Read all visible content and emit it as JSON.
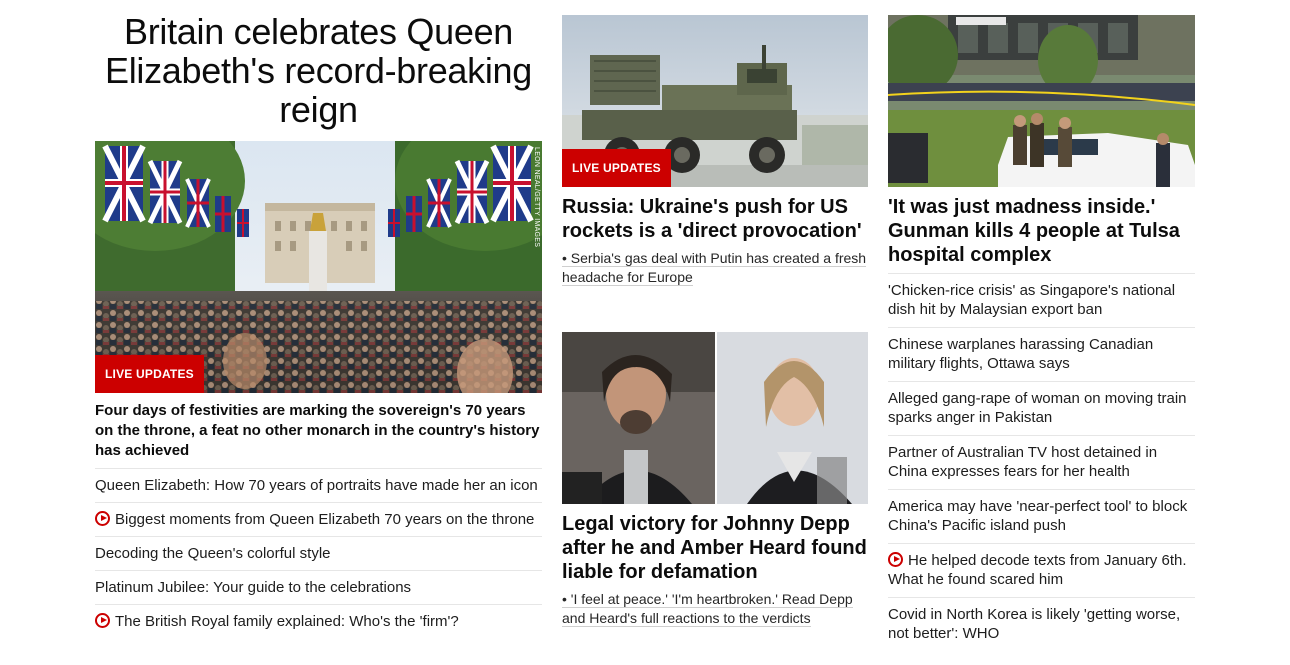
{
  "colors": {
    "accent": "#cc0000",
    "text": "#0c0c0c",
    "divider": "#e6e6e6"
  },
  "main": {
    "title": "Britain celebrates Queen Elizabeth's record-breaking reign",
    "image_credit": "LEON NEAL/GETTY IMAGES",
    "badge": "LIVE UPDATES",
    "subhead": "Four days of festivities are marking the sovereign's 70 years on the throne, a feat no other monarch in the country's history has achieved",
    "links": [
      {
        "text": "Queen Elizabeth: How 70 years of portraits have made her an icon",
        "icon": ""
      },
      {
        "text": "Biggest moments from Queen Elizabeth 70 years on the throne",
        "icon": "play-icon"
      },
      {
        "text": "Decoding the Queen's colorful style",
        "icon": ""
      },
      {
        "text": "Platinum Jubilee: Your guide to the celebrations",
        "icon": ""
      },
      {
        "text": "The British Royal family explained: Who's the 'firm'?",
        "icon": "play-icon"
      }
    ]
  },
  "middle": {
    "card1": {
      "badge": "LIVE UPDATES",
      "title": "Russia: Ukraine's push for US rockets is a 'direct provocation'",
      "sub": "• Serbia's gas deal with Putin has created a fresh headache for Europe"
    },
    "card2": {
      "title": "Legal victory for Johnny Depp after he and Amber Heard found liable for defamation",
      "sub": "• 'I feel at peace.' 'I'm heartbroken.' Read Depp and Heard's full reactions to the verdicts"
    }
  },
  "right": {
    "title": "'It was just madness inside.' Gunman kills 4 people at Tulsa hospital complex",
    "links": [
      {
        "text": "'Chicken-rice crisis' as Singapore's national dish hit by Malaysian export ban",
        "icon": ""
      },
      {
        "text": "Chinese warplanes harassing Canadian military flights, Ottawa says",
        "icon": ""
      },
      {
        "text": "Alleged gang-rape of woman on moving train sparks anger in Pakistan",
        "icon": ""
      },
      {
        "text": "Partner of Australian TV host detained in China expresses fears for her health",
        "icon": ""
      },
      {
        "text": "America may have 'near-perfect tool' to block China's Pacific island push",
        "icon": ""
      },
      {
        "text": "He helped decode texts from January 6th. What he found scared him",
        "icon": "play-icon"
      },
      {
        "text": "Covid in North Korea is likely 'getting worse, not better': WHO",
        "icon": ""
      }
    ]
  }
}
